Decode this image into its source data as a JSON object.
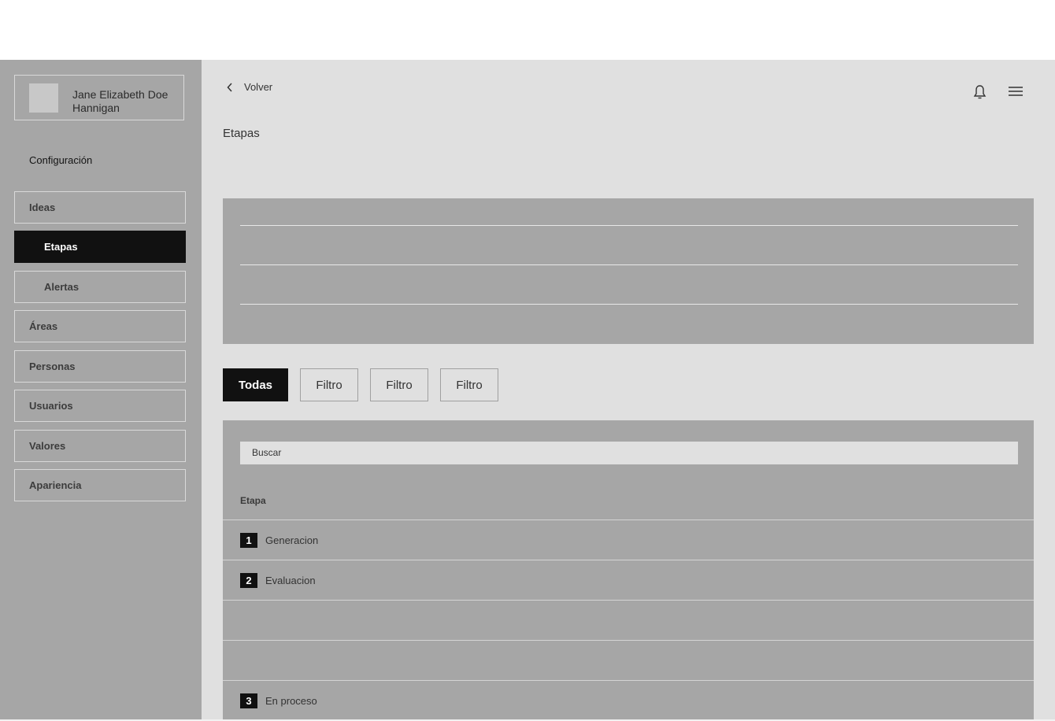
{
  "profile": {
    "name": "Jane Elizabeth Doe Hannigan"
  },
  "sidebar": {
    "section_title": "Configuración",
    "items": [
      {
        "label": "Ideas"
      },
      {
        "label": "Etapas"
      },
      {
        "label": "Alertas"
      },
      {
        "label": "Áreas"
      },
      {
        "label": "Personas"
      },
      {
        "label": "Usuarios"
      },
      {
        "label": "Valores"
      },
      {
        "label": "Apariencia"
      }
    ],
    "active": "Etapas"
  },
  "header": {
    "back_label": "Volver",
    "page_title": "Etapas",
    "icons": [
      "chevron-left-icon",
      "bell-icon",
      "hamburger-menu-icon"
    ]
  },
  "filters": [
    {
      "label": "Todas",
      "active": true
    },
    {
      "label": "Filtro",
      "active": false
    },
    {
      "label": "Filtro",
      "active": false
    },
    {
      "label": "Filtro",
      "active": false
    }
  ],
  "list": {
    "search_placeholder": "Buscar",
    "column_header": "Etapa",
    "rows": [
      {
        "number": "1",
        "label": "Generacion"
      },
      {
        "number": "2",
        "label": "Evaluacion"
      },
      {
        "number": "",
        "label": ""
      },
      {
        "number": "",
        "label": ""
      },
      {
        "number": "3",
        "label": "En proceso"
      }
    ]
  },
  "colors": {
    "sidebar_bg": "#a6a6a6",
    "main_bg": "#e0e0e0",
    "active_bg": "#111111",
    "panel_bg": "#a6a6a6"
  }
}
